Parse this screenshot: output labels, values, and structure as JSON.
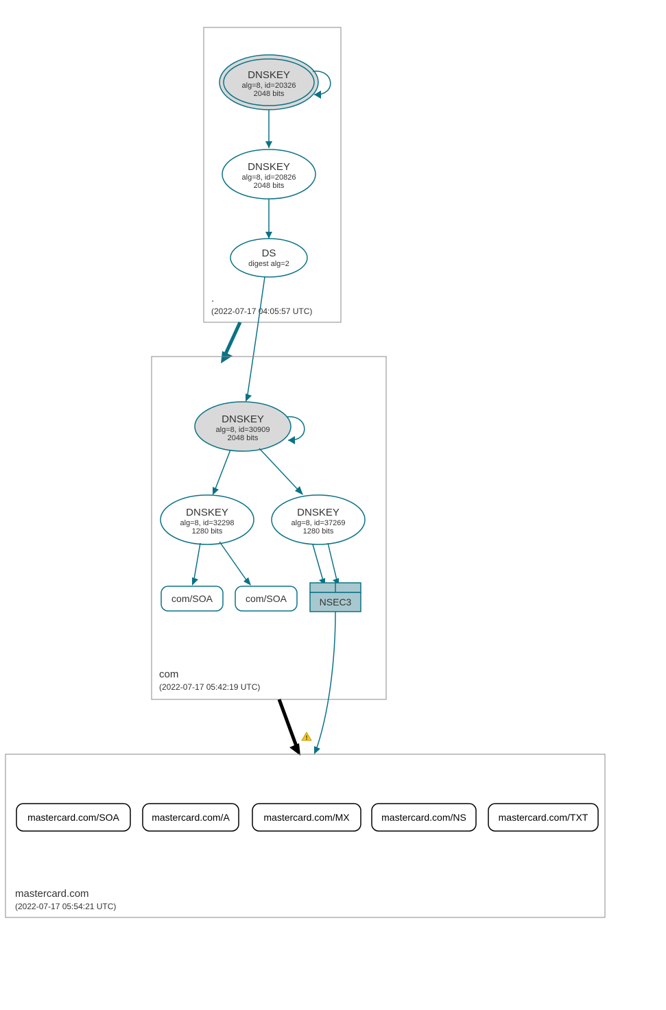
{
  "zones": {
    "root": {
      "label": ".",
      "timestamp": "(2022-07-17 04:05:57 UTC)",
      "nodes": {
        "ksk": {
          "title": "DNSKEY",
          "line1": "alg=8, id=20326",
          "line2": "2048 bits"
        },
        "zsk": {
          "title": "DNSKEY",
          "line1": "alg=8, id=20826",
          "line2": "2048 bits"
        },
        "ds": {
          "title": "DS",
          "line1": "digest alg=2"
        }
      }
    },
    "com": {
      "label": "com",
      "timestamp": "(2022-07-17 05:42:19 UTC)",
      "nodes": {
        "ksk": {
          "title": "DNSKEY",
          "line1": "alg=8, id=30909",
          "line2": "2048 bits"
        },
        "zsk1": {
          "title": "DNSKEY",
          "line1": "alg=8, id=32298",
          "line2": "1280 bits"
        },
        "zsk2": {
          "title": "DNSKEY",
          "line1": "alg=8, id=37269",
          "line2": "1280 bits"
        },
        "soa1": {
          "label": "com/SOA"
        },
        "soa2": {
          "label": "com/SOA"
        },
        "nsec3": {
          "label": "NSEC3"
        }
      }
    },
    "mastercard": {
      "label": "mastercard.com",
      "timestamp": "(2022-07-17 05:54:21 UTC)",
      "records": {
        "soa": "mastercard.com/SOA",
        "a": "mastercard.com/A",
        "mx": "mastercard.com/MX",
        "ns": "mastercard.com/NS",
        "txt": "mastercard.com/TXT"
      }
    }
  },
  "warning_icon": "⚠"
}
